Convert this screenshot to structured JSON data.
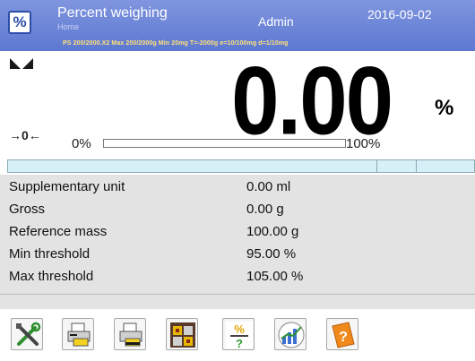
{
  "header": {
    "mode_title": "Percent weighing",
    "mode_subtitle": "Home",
    "user": "Admin",
    "date": "2016-09-02",
    "scale_spec": "PS 200/2000.X2   Max 200/2000g   Min 20mg   T=-2000g   e=10/100mg   d=1/10mg",
    "mode_icon_symbol": "%"
  },
  "weighing": {
    "value": "0.00",
    "unit": "%",
    "zero_indicator": "→0←",
    "bargraph_min": "0%",
    "bargraph_max": "100%",
    "bargraph_level": 0
  },
  "info_rows": [
    {
      "label": "Supplementary unit",
      "value": "0.00 ml"
    },
    {
      "label": "Gross",
      "value": "0.00 g"
    },
    {
      "label": "Reference mass",
      "value": "100.00 g"
    },
    {
      "label": "Min threshold",
      "value": "95.00 %"
    },
    {
      "label": "Max threshold",
      "value": "105.00 %"
    }
  ],
  "toolbar": {
    "buttons": [
      {
        "icon": "tools-icon"
      },
      {
        "icon": "print-icon"
      },
      {
        "icon": "print-footer-icon"
      },
      {
        "icon": "database-icon"
      },
      {
        "icon": "percent-reference-icon"
      },
      {
        "icon": "statistics-icon"
      },
      {
        "icon": "help-icon"
      }
    ]
  },
  "colors": {
    "header_top": "#7f95de",
    "header_bottom": "#5d78d1",
    "spec_text": "#ffe27a",
    "info_bar": "#d7eff6",
    "panel_bg": "#e3e3e3"
  }
}
